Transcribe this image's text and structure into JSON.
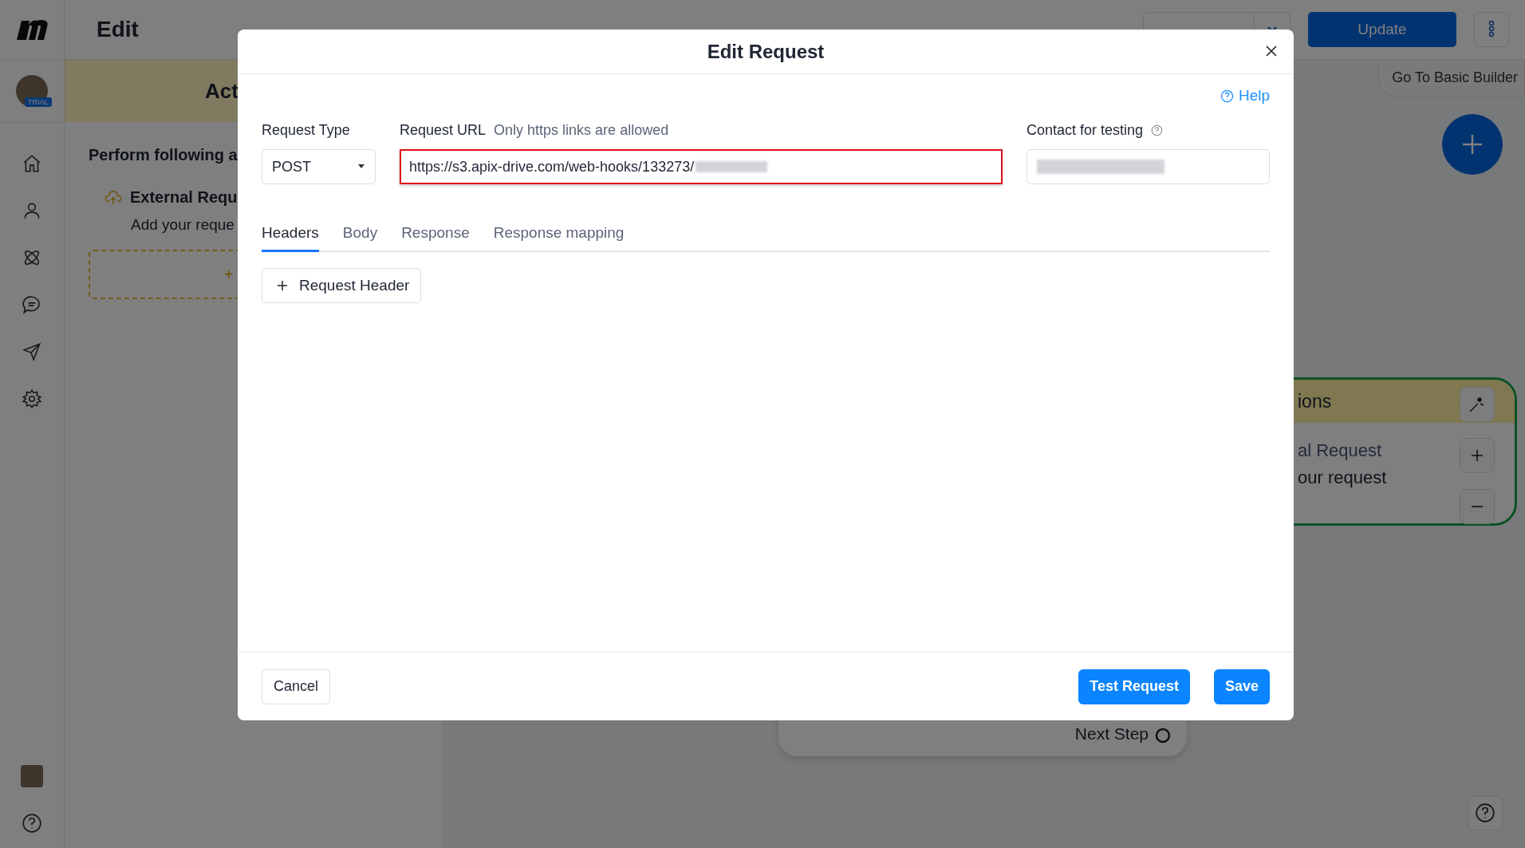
{
  "app": {
    "title": "Edit",
    "trial_badge": "TRIAL",
    "update": "Update",
    "basic_builder": "Go To Basic Builder"
  },
  "left_panel": {
    "header": "Act",
    "heading": "Perform following a",
    "action_title": "External Requ",
    "action_subtitle": "Add your reque",
    "add_button": "+"
  },
  "canvas": {
    "card_header": "ions",
    "card_title": "al Request",
    "card_subtitle": "our request",
    "next_step": "Next Step"
  },
  "modal": {
    "title": "Edit Request",
    "help": "Help",
    "request_type": {
      "label": "Request Type",
      "value": "POST"
    },
    "request_url": {
      "label": "Request URL",
      "hint": "Only https links are allowed",
      "value": "https://s3.apix-drive.com/web-hooks/133273/",
      "highlighted": true
    },
    "contact": {
      "label": "Contact for testing"
    },
    "tabs": [
      {
        "label": "Headers",
        "selected": true
      },
      {
        "label": "Body",
        "selected": false
      },
      {
        "label": "Response",
        "selected": false
      },
      {
        "label": "Response mapping",
        "selected": false
      }
    ],
    "add_header": "Request Header",
    "buttons": {
      "cancel": "Cancel",
      "test": "Test Request",
      "save": "Save"
    }
  }
}
